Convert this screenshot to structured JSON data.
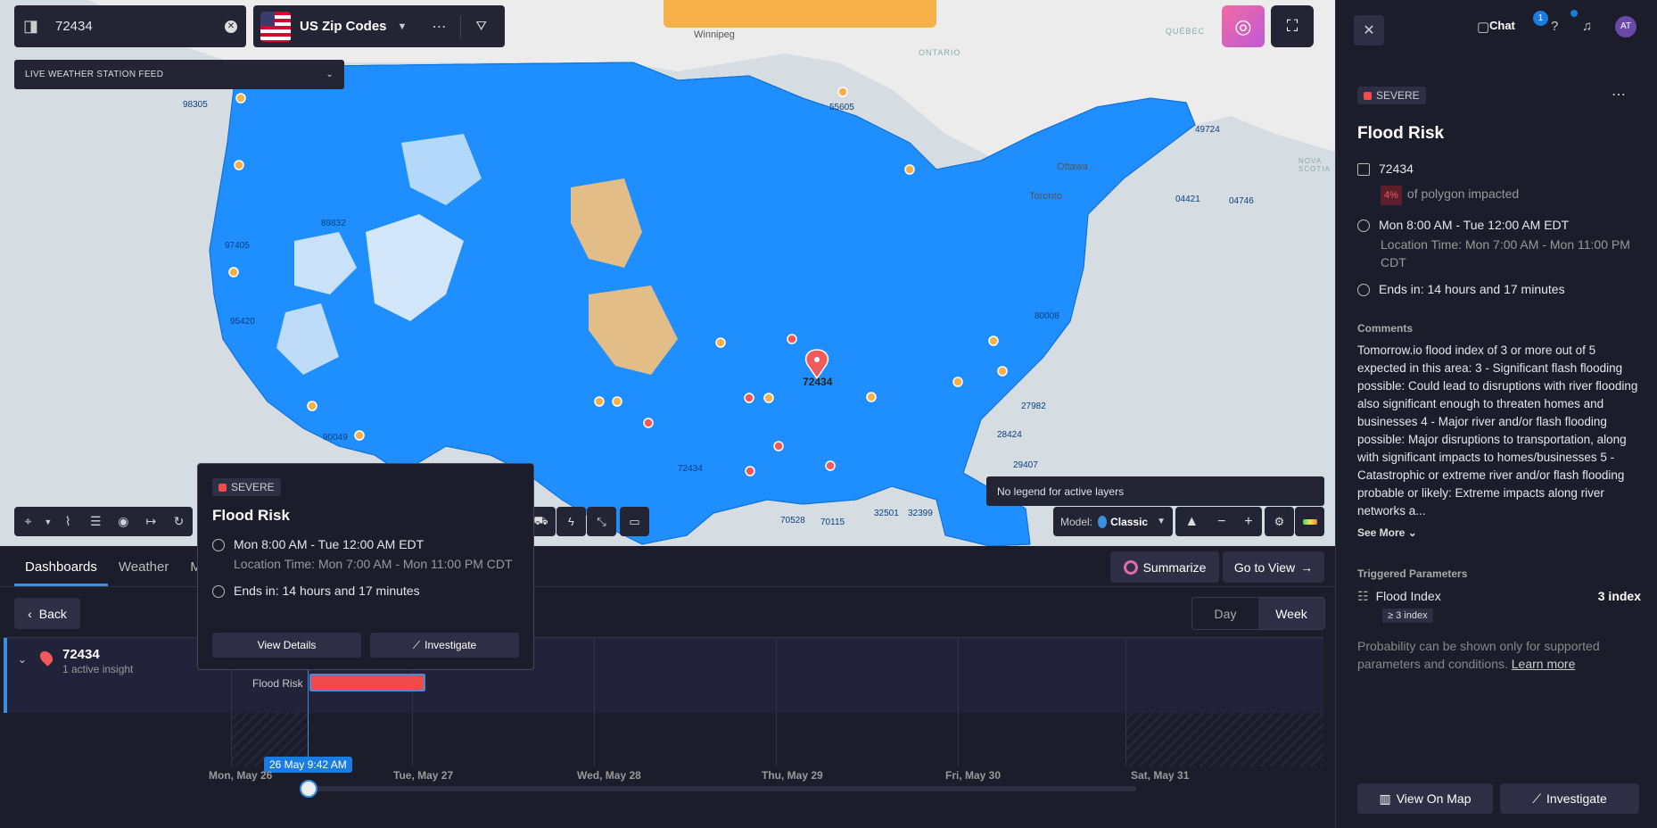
{
  "map": {
    "search_value": "72434",
    "layer_label": "US Zip Codes",
    "feed_label": "LIVE WEATHER STATION FEED",
    "legend_note": "No legend for active layers",
    "model_prefix": "Model:",
    "model_value": "Classic",
    "selected_pin_label": "72434",
    "place_labels": [
      "Winnipeg",
      "ONTARIO",
      "QUÉBEC",
      "Ottawa",
      "Toronto",
      "NOVA SCOTIA"
    ],
    "zip_labels": [
      "98305",
      "55605",
      "49724",
      "04746",
      "04421",
      "89832",
      "80008",
      "72434",
      "32501",
      "32399",
      "70115",
      "70528",
      "27982",
      "28424",
      "29407",
      "90049",
      "95420",
      "97405"
    ],
    "colors": {
      "fill": "#1f8fff",
      "point": "#1a7be0",
      "orange": "#f7b04a",
      "red": "#f05a5a"
    }
  },
  "bottom": {
    "tabs": [
      "Dashboards",
      "Weather",
      "M"
    ],
    "summarize": "Summarize",
    "go_to_view": "Go to View",
    "back": "Back",
    "range": {
      "day": "Day",
      "week": "Week"
    },
    "row": {
      "name": "72434",
      "sub": "1 active insight",
      "flood_label": "Flood Risk"
    },
    "now_tag": "26 May 9:42 AM",
    "days": [
      "Mon, May 26",
      "Tue, May 27",
      "Wed, May 28",
      "Thu, May 29",
      "Fri, May 30",
      "Sat, May 31"
    ]
  },
  "popup": {
    "severity": "SEVERE",
    "title": "Flood Risk",
    "time": "Mon 8:00 AM - Tue 12:00 AM EDT",
    "location_time": "Location Time: Mon 7:00 AM - Mon 11:00 PM CDT",
    "ends_in": "Ends in: 14 hours and 17 minutes",
    "view_details": "View Details",
    "investigate": "Investigate"
  },
  "panel": {
    "chat": "Chat",
    "chat_badge": "1",
    "avatar": "AT",
    "severity": "SEVERE",
    "title": "Flood Risk",
    "zip": "72434",
    "pct": "4%",
    "pct_text": "of polygon impacted",
    "time": "Mon 8:00 AM - Tue 12:00 AM EDT",
    "location_time": "Location Time: Mon 7:00 AM - Mon 11:00 PM CDT",
    "ends_in": "Ends in: 14 hours and 17 minutes",
    "comments_title": "Comments",
    "comments": "Tomorrow.io flood index of 3 or more out of 5 expected in this area: 3 - Significant flash flooding possible: Could lead to disruptions with river flooding also significant enough to threaten homes and businesses 4 - Major river and/or flash flooding possible: Major disruptions to transportation, along with significant impacts to homes/businesses 5 - Catastrophic or extreme river and/or flash flooding probable or likely: Extreme impacts along river networks a...",
    "see_more": "See More",
    "triggered_title": "Triggered Parameters",
    "param_name": "Flood Index",
    "param_value": "3 index",
    "param_chip": "≥ 3 index",
    "prob_text": "Probability can be shown only for supported parameters and conditions.",
    "learn_more": "Learn more",
    "view_on_map": "View On Map",
    "investigate": "Investigate"
  }
}
